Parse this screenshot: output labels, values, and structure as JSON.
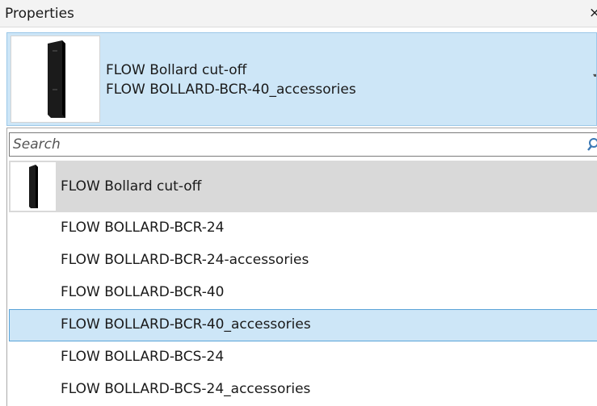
{
  "panel": {
    "title": "Properties",
    "close_glyph": "×"
  },
  "type_selector": {
    "family": "FLOW Bollard cut-off",
    "type": "FLOW BOLLARD-BCR-40_accessories",
    "thumbnail_icon": "bollard-icon",
    "caret_glyph": "▾"
  },
  "search": {
    "placeholder": "Search",
    "value": "",
    "icon": "search-icon"
  },
  "list": {
    "family_header": "FLOW Bollard cut-off",
    "items": [
      {
        "label": "FLOW BOLLARD-BCR-24"
      },
      {
        "label": "FLOW BOLLARD-BCR-24-accessories"
      },
      {
        "label": "FLOW BOLLARD-BCR-40"
      },
      {
        "label": "FLOW BOLLARD-BCR-40_accessories",
        "selected": true
      },
      {
        "label": "FLOW BOLLARD-BCS-24"
      },
      {
        "label": "FLOW BOLLARD-BCS-24_accessories"
      }
    ]
  },
  "colors": {
    "selection_bg": "#cde6f7",
    "selection_border": "#5aa3d8",
    "family_row_bg": "#d9d9d9"
  }
}
